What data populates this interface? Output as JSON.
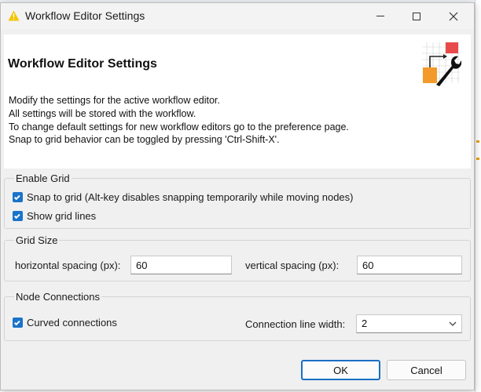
{
  "window": {
    "title": "Workflow Editor Settings",
    "controls": {
      "minimize_icon": "minimize-icon",
      "maximize_icon": "maximize-icon",
      "close_glyph": "✕"
    }
  },
  "banner": {
    "title": "Workflow Editor Settings",
    "description_lines": [
      "Modify the settings for the active workflow editor.",
      "All settings will be stored with the workflow.",
      "To change default settings for new workflow editors go to the preference page.",
      "Snap to grid behavior can be toggled by pressing 'Ctrl-Shift-X'."
    ],
    "icon": "workflow-settings-icon"
  },
  "enable_grid": {
    "label": "Enable Grid",
    "snap_to_grid": {
      "label": "Snap to grid (Alt-key disables snapping temporarily while moving nodes)",
      "checked": true
    },
    "show_grid_lines": {
      "label": "Show grid lines",
      "checked": true
    }
  },
  "grid_size": {
    "label": "Grid Size",
    "horizontal": {
      "label": "horizontal spacing (px):",
      "value": "60"
    },
    "vertical": {
      "label": "vertical spacing (px):",
      "value": "60"
    }
  },
  "node_connections": {
    "label": "Node Connections",
    "curved": {
      "label": "Curved connections",
      "checked": true
    },
    "line_width": {
      "label": "Connection line width:",
      "value": "2"
    }
  },
  "buttons": {
    "ok": "OK",
    "cancel": "Cancel"
  },
  "colors": {
    "accent": "#1a73c9",
    "warning_yellow": "#f5c400",
    "icon_orange": "#f39a2b",
    "icon_red": "#e84a4a"
  }
}
